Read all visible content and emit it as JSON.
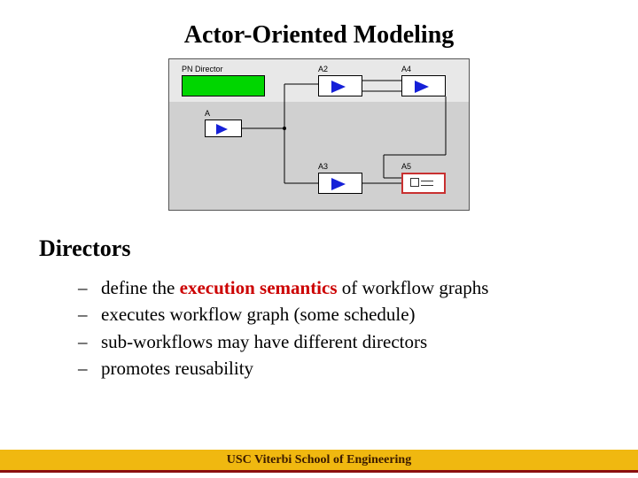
{
  "title": "Actor-Oriented Modeling",
  "diagram": {
    "director_label": "PN Director",
    "actors": {
      "a": "A",
      "a2": "A2",
      "a3": "A3",
      "a4": "A4",
      "a5": "A5"
    }
  },
  "section_heading": "Directors",
  "bullets": [
    {
      "prefix": "define the ",
      "highlight": "execution semantics",
      "suffix": " of workflow graphs"
    },
    {
      "prefix": "executes workflow graph (some schedule)",
      "highlight": "",
      "suffix": ""
    },
    {
      "prefix": "sub-workflows may have different directors",
      "highlight": "",
      "suffix": ""
    },
    {
      "prefix": "promotes reusability",
      "highlight": "",
      "suffix": ""
    }
  ],
  "footer": "USC Viterbi School of Engineering"
}
